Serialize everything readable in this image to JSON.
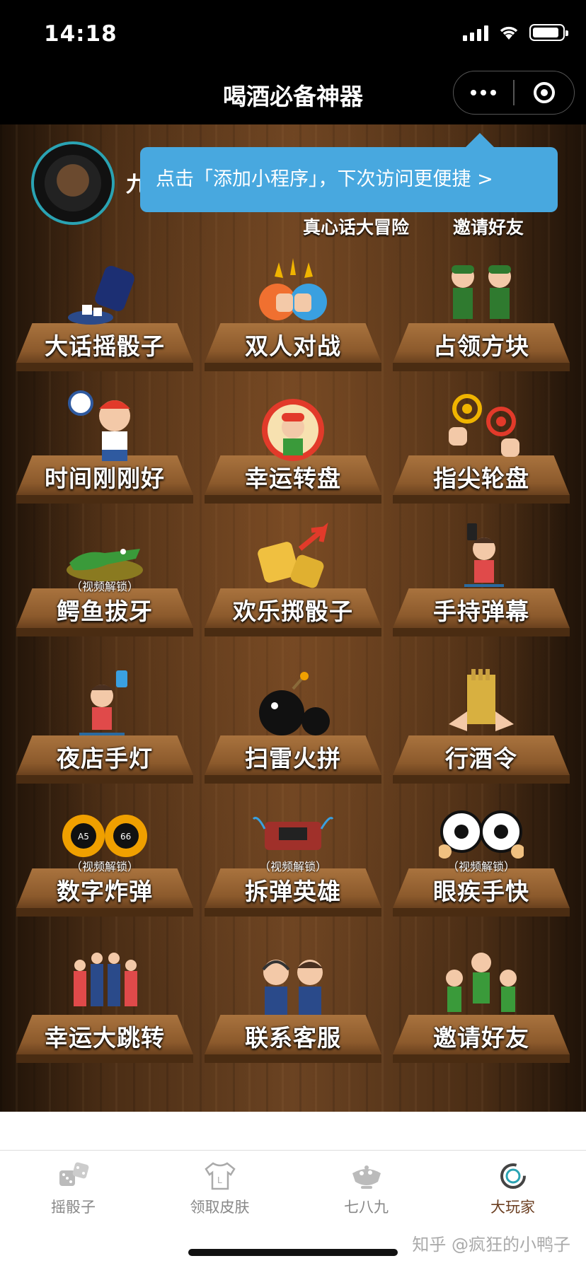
{
  "status": {
    "time": "14:18"
  },
  "nav": {
    "title": "喝酒必备神器"
  },
  "profile": {
    "name_partial": "九"
  },
  "tip": {
    "text": "点击「添加小程序」，下次访问更便捷 >"
  },
  "top_links": [
    {
      "label": "真心话大冒险"
    },
    {
      "label": "邀请好友"
    }
  ],
  "games": [
    {
      "label": "大话摇骰子",
      "icon": "dice-cup-icon",
      "lock": ""
    },
    {
      "label": "双人对战",
      "icon": "fist-bump-icon",
      "lock": ""
    },
    {
      "label": "占领方块",
      "icon": "soldiers-icon",
      "lock": ""
    },
    {
      "label": "时间刚刚好",
      "icon": "alarm-clock-icon",
      "lock": ""
    },
    {
      "label": "幸运转盘",
      "icon": "lucky-wheel-icon",
      "lock": ""
    },
    {
      "label": "指尖轮盘",
      "icon": "fingertip-icon",
      "lock": ""
    },
    {
      "label": "鳄鱼拔牙",
      "icon": "crocodile-icon",
      "lock": "（视频解锁）"
    },
    {
      "label": "欢乐掷骰子",
      "icon": "golden-dice-icon",
      "lock": ""
    },
    {
      "label": "手持弹幕",
      "icon": "handheld-danmaku-icon",
      "lock": ""
    },
    {
      "label": "夜店手灯",
      "icon": "phone-light-icon",
      "lock": ""
    },
    {
      "label": "扫雷火拼",
      "icon": "bomb-icon",
      "lock": ""
    },
    {
      "label": "行酒令",
      "icon": "scroll-icon",
      "lock": ""
    },
    {
      "label": "数字炸弹",
      "icon": "number-bomb-icon",
      "lock": "（视频解锁）"
    },
    {
      "label": "拆弹英雄",
      "icon": "dynamite-icon",
      "lock": "（视频解锁）"
    },
    {
      "label": "眼疾手快",
      "icon": "eyes-icon",
      "lock": "（视频解锁）"
    },
    {
      "label": "幸运大跳转",
      "icon": "dancers-icon",
      "lock": ""
    },
    {
      "label": "联系客服",
      "icon": "customer-service-icon",
      "lock": ""
    },
    {
      "label": "邀请好友",
      "icon": "invite-friends-icon",
      "lock": ""
    }
  ],
  "tabs": [
    {
      "label": "摇骰子",
      "icon": "dice-icon",
      "active": false
    },
    {
      "label": "领取皮肤",
      "icon": "shirt-icon",
      "active": false
    },
    {
      "label": "七八九",
      "icon": "bowl-icon",
      "active": false
    },
    {
      "label": "大玩家",
      "icon": "big-player-icon",
      "active": true
    }
  ],
  "watermark": "知乎 @疯狂的小鸭子"
}
